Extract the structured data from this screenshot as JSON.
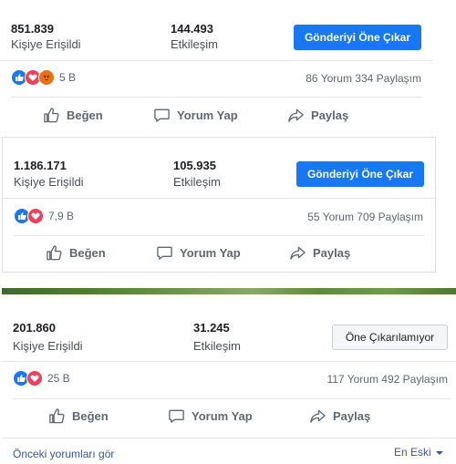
{
  "posts": [
    {
      "reach_value": "851.839",
      "reach_label": "Kişiye Erişildi",
      "engagement_value": "144.493",
      "engagement_label": "Etkileşim",
      "boost_label": "Gönderiyi Öne Çıkar",
      "reaction_count": "5 B",
      "counts": "86 Yorum  334 Paylaşım",
      "like_label": "Beğen",
      "comment_label": "Yorum Yap",
      "share_label": "Paylaş"
    },
    {
      "reach_value": "1.186.171",
      "reach_label": "Kişiye Erişildi",
      "engagement_value": "105.935",
      "engagement_label": "Etkileşim",
      "boost_label": "Gönderiyi Öne Çıkar",
      "reaction_count": "7,9 B",
      "counts": "55 Yorum  709 Paylaşım",
      "like_label": "Beğen",
      "comment_label": "Yorum Yap",
      "share_label": "Paylaş"
    },
    {
      "reach_value": "201.860",
      "reach_label": "Kişiye Erişildi",
      "engagement_value": "31.245",
      "engagement_label": "Etkileşim",
      "boost_label": "Öne Çıkarılamıyor",
      "reaction_count": "25 B",
      "counts": "117 Yorum  492 Paylaşım",
      "like_label": "Beğen",
      "comment_label": "Yorum Yap",
      "share_label": "Paylaş"
    }
  ],
  "footer": {
    "previous_comments": "Önceki yorumları gör",
    "sort_label": "En Eski"
  },
  "colors": {
    "accent": "#1877f2",
    "like": "#1877f2",
    "love": "#f33e58",
    "angry": "#e9710f",
    "link": "#385898"
  },
  "icons": [
    "like-reaction-icon",
    "love-reaction-icon",
    "angry-reaction-icon",
    "thumbs-up-icon",
    "comment-icon",
    "share-icon",
    "caret-down-icon"
  ]
}
